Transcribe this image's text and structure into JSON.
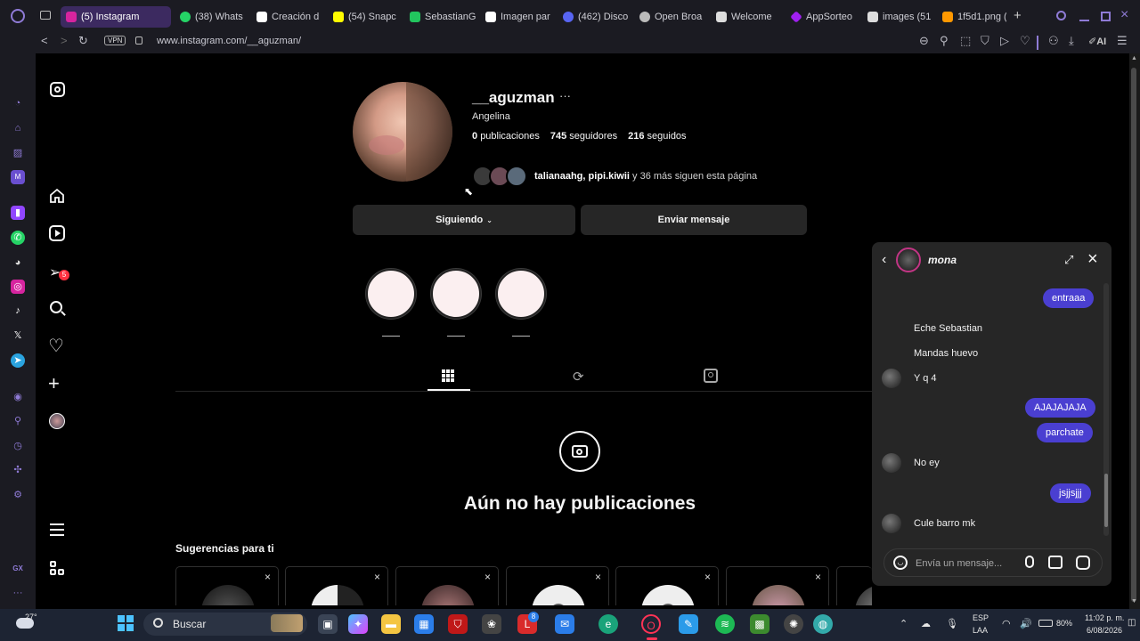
{
  "browser": {
    "tabs": [
      {
        "label": "(5) Instagram",
        "active": true,
        "color": "#d6249f"
      },
      {
        "label": "(38) Whats",
        "color": "#25d366"
      },
      {
        "label": "Creación d",
        "color": "#ffffff"
      },
      {
        "label": "(54) Snapc",
        "color": "#fffc00"
      },
      {
        "label": "SebastianG",
        "color": "#22c55e"
      },
      {
        "label": "Imagen par",
        "color": "#ffffff"
      },
      {
        "label": "(462) Disco",
        "color": "#5865f2"
      },
      {
        "label": "Open Broa",
        "color": "#bbbbbb"
      },
      {
        "label": "Welcome",
        "color": "#dddddd"
      },
      {
        "label": "AppSorteo",
        "color": "#a020f0"
      },
      {
        "label": "images (51",
        "color": "#dddddd"
      },
      {
        "label": "1f5d1.png (",
        "color": "#ff9800"
      }
    ],
    "url": "www.instagram.com/__aguzman/",
    "vpn_label": "VPN",
    "ai_label": "AI"
  },
  "profile": {
    "username": "__aguzman",
    "more": "···",
    "full_name": "Angelina",
    "posts_count": "0",
    "posts_label": "publicaciones",
    "followers_count": "745",
    "followers_label": "seguidores",
    "following_count": "216",
    "following_label": "seguidos",
    "followed_by_names": "talianaahg, pipi.kiwii",
    "followed_by_rest": "y 36 más siguen esta página",
    "following_button": "Siguiendo",
    "message_button": "Enviar mensaje"
  },
  "posts": {
    "empty_title": "Aún no hay publicaciones"
  },
  "suggestions": {
    "title": "Sugerencias para ti",
    "close_icon": "×"
  },
  "chat": {
    "name": "mona",
    "messages": [
      {
        "dir": "out",
        "text": "entraaa"
      },
      {
        "dir": "in",
        "text": "Eche Sebastian"
      },
      {
        "dir": "in",
        "text": "Mandas huevo"
      },
      {
        "dir": "in",
        "text": "Y q 4"
      },
      {
        "dir": "out",
        "text": "AJAJAJAJA"
      },
      {
        "dir": "out",
        "text": "parchate"
      },
      {
        "dir": "in",
        "text": "No ey"
      },
      {
        "dir": "out",
        "text": "jsjjsjjj"
      },
      {
        "dir": "in",
        "text": "Cule barro mk"
      }
    ],
    "input_placeholder": "Envía un mensaje..."
  },
  "taskbar": {
    "weather": "27°",
    "search_placeholder": "Buscar",
    "lang": "ESP",
    "lang2": "LAA",
    "battery": "80%",
    "time": "11:02 p. m.",
    "date": "6/08/2026",
    "badge_count": "8"
  },
  "sidebar": {
    "badge_count": "5"
  },
  "colors": {
    "accent": "#4a3fd1",
    "background": "#000000",
    "panel": "#262626"
  }
}
